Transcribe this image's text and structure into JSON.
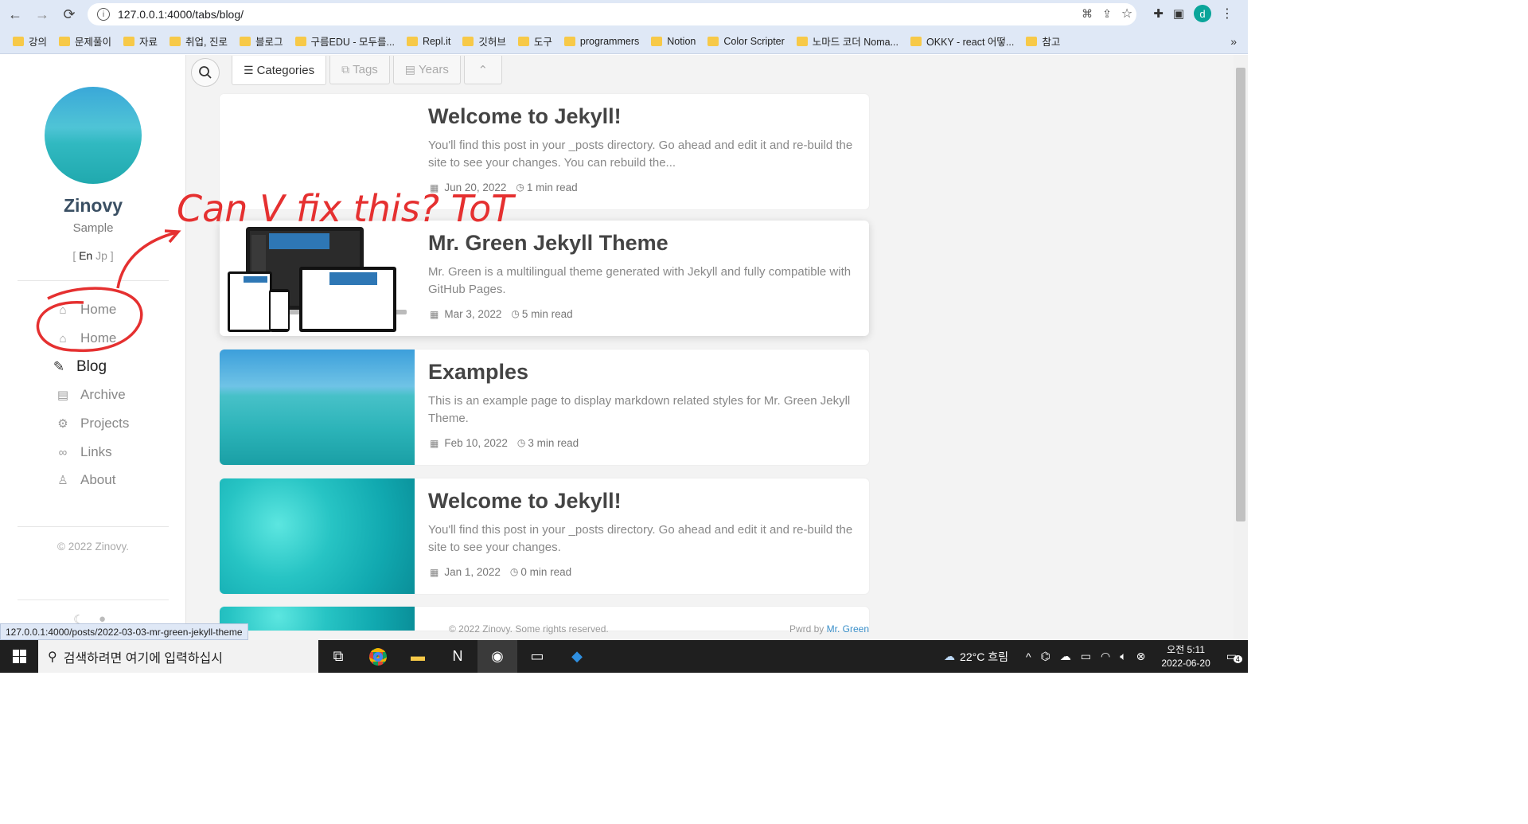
{
  "browser": {
    "url": "127.0.0.1:4000/tabs/blog/",
    "status_url": "127.0.0.1:4000/posts/2022-03-03-mr-green-jekyll-theme",
    "profile_initial": "d",
    "bookmarks": [
      "강의",
      "문제풀이",
      "자료",
      "취업, 진로",
      "블로그",
      "구름EDU - 모두를...",
      "Repl.it",
      "깃허브",
      "도구",
      "programmers",
      "Notion",
      "Color Scripter",
      "노마드 코더 Noma...",
      "OKKY - react 어떻...",
      "참고"
    ]
  },
  "sidebar": {
    "title": "Zinovy",
    "subtitle": "Sample",
    "lang_open": "[",
    "lang_en": "En",
    "lang_jp": "Jp",
    "lang_close": "]",
    "items": [
      {
        "label": "Home",
        "icon": "home-icon"
      },
      {
        "label": "Home",
        "icon": "home-icon"
      },
      {
        "label": "Blog",
        "icon": "edit-icon"
      },
      {
        "label": "Archive",
        "icon": "archive-icon"
      },
      {
        "label": "Projects",
        "icon": "gear-icon"
      },
      {
        "label": "Links",
        "icon": "link-icon"
      },
      {
        "label": "About",
        "icon": "user-icon"
      }
    ],
    "copyright": "© 2022 Zinovy."
  },
  "toolbar": {
    "tabs": [
      "Categories",
      "Tags",
      "Years"
    ]
  },
  "posts": [
    {
      "title": "Welcome to Jekyll!",
      "excerpt": "You'll find this post in your _posts directory. Go ahead and edit it and re-build the site to see your changes. You can rebuild the...",
      "date": "Jun 20, 2022",
      "read": "1 min read"
    },
    {
      "title": "Mr. Green Jekyll Theme",
      "excerpt": "Mr. Green is a multilingual theme generated with Jekyll and fully compatible with GitHub Pages.",
      "date": "Mar 3, 2022",
      "read": "5 min read"
    },
    {
      "title": "Examples",
      "excerpt": "This is an example page to display markdown related styles for Mr. Green Jekyll Theme.",
      "date": "Feb 10, 2022",
      "read": "3 min read"
    },
    {
      "title": "Welcome to Jekyll!",
      "excerpt": "You'll find this post in your _posts directory. Go ahead and edit it and re-build the site to see your changes.",
      "date": "Jan 1, 2022",
      "read": "0 min read"
    }
  ],
  "footer": {
    "left": "© 2022 Zinovy. Some rights reserved.",
    "right_prefix": "Pwrd by",
    "right_link": "Mr. Green"
  },
  "annotation": {
    "text": "Can V fix this? ToT"
  },
  "taskbar": {
    "search_placeholder": "검색하려면 여기에 입력하십시",
    "weather": "22°C 흐림",
    "time": "오전 5:11",
    "date": "2022-06-20",
    "notifications": "4"
  }
}
